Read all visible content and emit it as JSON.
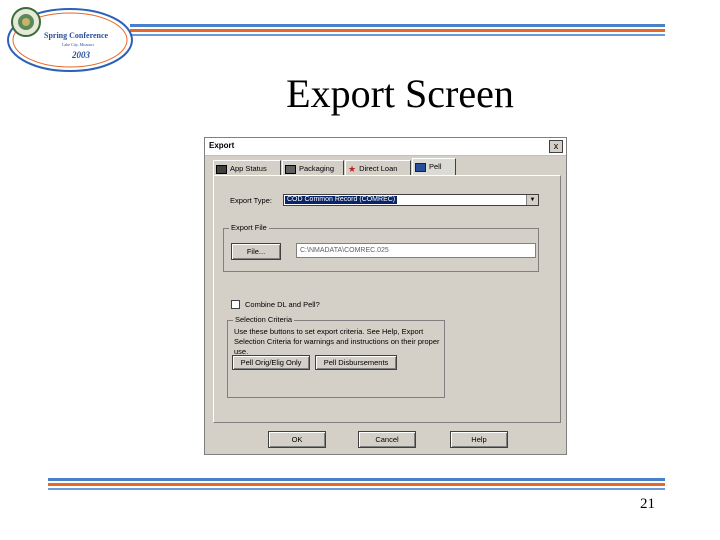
{
  "slide": {
    "logo_text": "Spring Conference",
    "logo_subtext": "Lake City, Missouri",
    "logo_year": "2003",
    "title": "Export Screen",
    "page_number": "21"
  },
  "dialog": {
    "title": "Export",
    "close_label": "x",
    "tabs": [
      {
        "label": "App Status",
        "icon": "app-status-icon"
      },
      {
        "label": "Packaging",
        "icon": "packaging-icon"
      },
      {
        "label": "Direct Loan",
        "icon": "direct-loan-star-icon"
      },
      {
        "label": "Pell",
        "icon": "pell-icon"
      }
    ],
    "active_tab": "Pell",
    "export_type_label": "Export Type:",
    "export_type_value": "COD Common Record (COMREC)",
    "export_file_legend": "Export File",
    "file_button_label": "File...",
    "file_path": "C:\\NMADATA\\COMREC.025",
    "combine_label": "Combine DL and Pell?",
    "combine_checked": false,
    "selection_legend": "Selection Criteria",
    "selection_text": "Use these buttons to set export criteria. See Help, Export Selection Criteria for warnings and instructions on their proper use.",
    "pell_orig_button": "Pell Orig/Elig Only",
    "pell_disb_button": "Pell Disbursements",
    "ok_button": "OK",
    "cancel_button": "Cancel",
    "help_button": "Help"
  },
  "colors": {
    "stripe_blue": "#4a7fc9",
    "stripe_orange": "#e8672a",
    "selection_highlight": "#0a246a",
    "dialog_face": "#d4d0c8"
  }
}
